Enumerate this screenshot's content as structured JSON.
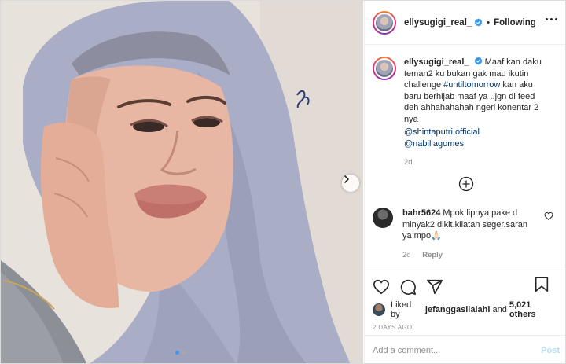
{
  "post": {
    "username": "ellysugigi_real_",
    "separator": "•",
    "follow_state": "Following"
  },
  "caption": {
    "username": "ellysugigi_real_",
    "text_1": "Maaf kan daku teman2 ku bukan gak mau ikutin challenge ",
    "hashtag": "#untiltomorrow",
    "text_2": " kan aku baru berhijab maaf ya ..jgn di feed deh ahhahahahah ngeri konentar 2 nya",
    "mention_1": "@shintaputri.official",
    "mention_2": "@nabillagomes",
    "time": "2d"
  },
  "comment": {
    "username": "bahr5624",
    "text": "Mpok lipnya pake d minyak2 dikit.kliatan seger.saran ya mpo🙏🏻",
    "time": "2d",
    "reply_label": "Reply"
  },
  "likes": {
    "prefix": "Liked by ",
    "user": "jefanggasilalahi",
    "middle": " and ",
    "count": "5,021 others"
  },
  "date": "2 DAYS AGO",
  "comment_box": {
    "placeholder": "Add a comment...",
    "post_label": "Post"
  },
  "carousel": {
    "total_slides": 2,
    "active_slide": 1
  },
  "colors": {
    "link": "#00376b",
    "verified": "#3897f0",
    "post_disabled": "#b2dffc",
    "hijab": "#a9adc6"
  },
  "icons": [
    "heart-icon",
    "comment-icon",
    "share-icon",
    "bookmark-icon",
    "more-options-icon",
    "verified-badge-icon",
    "load-more-comments-icon",
    "carousel-next-icon"
  ]
}
